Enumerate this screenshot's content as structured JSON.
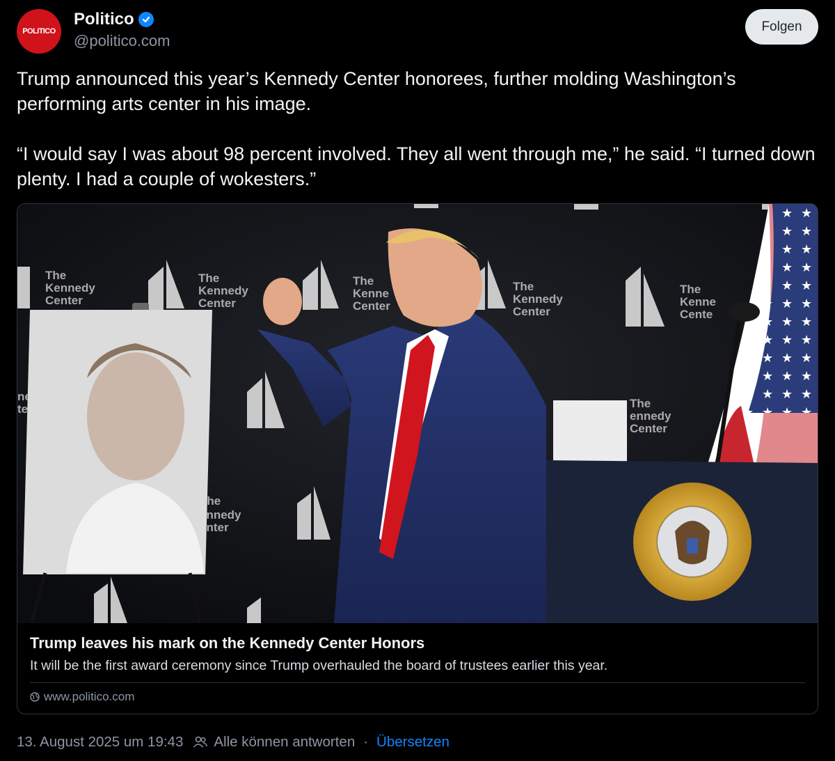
{
  "author": {
    "avatar_text": "POLITICO",
    "display_name": "Politico",
    "handle": "@politico.com",
    "verified": true
  },
  "follow_label": "Folgen",
  "post": {
    "paragraphs": [
      "Trump announced this year’s Kennedy Center honorees, further molding Washington’s performing arts center in his image.",
      "“I would say I was about 98 percent involved. They all went through me,” he said. “I turned down plenty. I had a couple of wokesters.”"
    ]
  },
  "link_card": {
    "title": "Trump leaves his mark on the Kennedy Center Honors",
    "description": "It will be the first award ceremony since Trump overhauled the board of trustees earlier this year.",
    "domain": "www.politico.com",
    "image": {
      "backdrop_text": [
        "The",
        "Kennedy",
        "Center"
      ]
    }
  },
  "footer": {
    "timestamp": "13. August 2025 um 19:43",
    "reply_setting": "Alle können antworten",
    "separator": "·",
    "translate_label": "Übersetzen"
  },
  "colors": {
    "background": "#000000",
    "accent": "#1185fe",
    "muted": "#8c96a3",
    "brand": "#d0121b"
  }
}
